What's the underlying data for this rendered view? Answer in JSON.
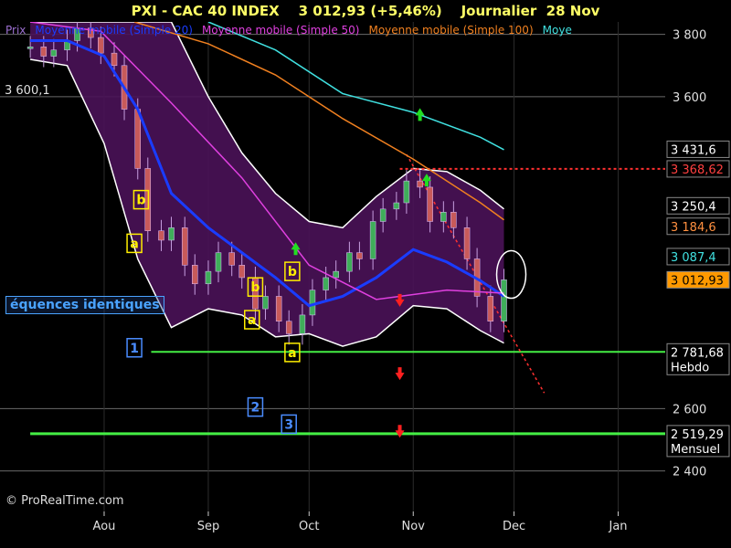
{
  "header": {
    "title": "PXI - CAC 40 INDEX    3 012,93 (+5,46%)    Journalier  28 Nov"
  },
  "legend": [
    {
      "label": "Prix",
      "color": "#9b6fd0"
    },
    {
      "label": "Moyenne mobile (Simple 20)",
      "color": "#1a3cff"
    },
    {
      "label": "Moyenne mobile (Simple 50)",
      "color": "#e040e0"
    },
    {
      "label": "Moyenne mobile (Simple 100)",
      "color": "#f08020"
    },
    {
      "label": "Moye",
      "color": "#40e0e0"
    }
  ],
  "copyright": "© ProRealTime.com",
  "annotation": "équences identiques",
  "chart_data": {
    "type": "candlestick",
    "y_scale": "linear",
    "ylim": [
      2270,
      3840
    ],
    "x_labels": [
      {
        "label": "Aou",
        "x": "2008-08-01"
      },
      {
        "label": "Sep",
        "x": "2008-09-01"
      },
      {
        "label": "Oct",
        "x": "2008-10-01"
      },
      {
        "label": "Nov",
        "x": "2008-11-01"
      },
      {
        "label": "Dec",
        "x": "2008-12-01"
      },
      {
        "label": "Jan",
        "x": "2009-01-01"
      }
    ],
    "y_ticks": [
      "3 800",
      "3 600",
      "2 600",
      "2 400"
    ],
    "left_label": {
      "text": "3 600,1",
      "value": 3600
    },
    "price_badges": [
      {
        "text": "3 431,6",
        "value": 3431.6,
        "bg": "#000000",
        "fg": "#ffffff"
      },
      {
        "text": "3 368,62",
        "value": 3368.62,
        "bg": "#000000",
        "fg": "#ff4040"
      },
      {
        "text": "3 250,4",
        "value": 3250.4,
        "bg": "#000000",
        "fg": "#ffffff"
      },
      {
        "text": "3 184,6",
        "value": 3184.6,
        "bg": "#000000",
        "fg": "#ff9040"
      },
      {
        "text": "3 087,4",
        "value": 3087.4,
        "bg": "#000000",
        "fg": "#40e0e0"
      },
      {
        "text": "3 012,93",
        "value": 3012.93,
        "bg": "#ff9900",
        "fg": "#000000"
      },
      {
        "text": "2 781,68",
        "value": 2781.68,
        "bg": "#000000",
        "fg": "#ffffff",
        "sub": "Hebdo"
      },
      {
        "text": "2 519,29",
        "value": 2519.29,
        "bg": "#000000",
        "fg": "#ffffff",
        "sub": "Mensuel"
      }
    ],
    "h_lines": [
      {
        "value": 2781.68,
        "color": "#44ee44",
        "width": 2,
        "from": "2008-08-15"
      },
      {
        "value": 2519.29,
        "color": "#44ee44",
        "width": 3,
        "from": "2008-07-10"
      },
      {
        "value": 3368.62,
        "color": "#ff3030",
        "width": 2,
        "dash": "3,3",
        "from": "2008-10-28"
      }
    ],
    "trendline": {
      "from": {
        "x": "2008-10-30",
        "y": 3415
      },
      "to": {
        "x": "2008-12-10",
        "y": 2650
      },
      "color": "#ff3030"
    },
    "series": [
      {
        "name": "Prix",
        "color": "#9b6fd0",
        "x": [
          "2008-07-10",
          "2008-07-14",
          "2008-07-17",
          "2008-07-21",
          "2008-07-24",
          "2008-07-28",
          "2008-07-31",
          "2008-08-04",
          "2008-08-07",
          "2008-08-11",
          "2008-08-14",
          "2008-08-18",
          "2008-08-21",
          "2008-08-25",
          "2008-08-28",
          "2008-09-01",
          "2008-09-04",
          "2008-09-08",
          "2008-09-11",
          "2008-09-15",
          "2008-09-18",
          "2008-09-22",
          "2008-09-25",
          "2008-09-29",
          "2008-10-02",
          "2008-10-06",
          "2008-10-09",
          "2008-10-13",
          "2008-10-16",
          "2008-10-20",
          "2008-10-23",
          "2008-10-27",
          "2008-10-30",
          "2008-11-03",
          "2008-11-06",
          "2008-11-10",
          "2008-11-13",
          "2008-11-17",
          "2008-11-20",
          "2008-11-24",
          "2008-11-28"
        ],
        "values": [
          3760,
          3730,
          3750,
          3780,
          3820,
          3790,
          3740,
          3700,
          3560,
          3370,
          3170,
          3140,
          3180,
          3060,
          3000,
          3040,
          3100,
          3060,
          3020,
          2920,
          2960,
          2880,
          2840,
          2900,
          2980,
          3020,
          3040,
          3100,
          3080,
          3200,
          3240,
          3260,
          3330,
          3310,
          3200,
          3230,
          3180,
          3080,
          2960,
          2880,
          3012.93
        ]
      },
      {
        "name": "Moyenne mobile (Simple 20)",
        "color": "#1a3cff",
        "x": [
          "2008-07-10",
          "2008-07-21",
          "2008-08-01",
          "2008-08-11",
          "2008-08-21",
          "2008-09-01",
          "2008-09-11",
          "2008-09-21",
          "2008-10-01",
          "2008-10-11",
          "2008-10-21",
          "2008-11-01",
          "2008-11-11",
          "2008-11-21",
          "2008-11-28"
        ],
        "values": [
          3780,
          3780,
          3730,
          3560,
          3290,
          3180,
          3100,
          3020,
          2930,
          2960,
          3020,
          3110,
          3070,
          3010,
          2960
        ]
      },
      {
        "name": "Moyenne mobile (Simple 50)",
        "color": "#e040e0",
        "x": [
          "2008-07-10",
          "2008-07-31",
          "2008-08-21",
          "2008-09-11",
          "2008-10-01",
          "2008-10-21",
          "2008-11-11",
          "2008-11-28"
        ],
        "values": [
          3840,
          3810,
          3580,
          3340,
          3060,
          2950,
          2980,
          2970
        ]
      },
      {
        "name": "Moyenne mobile (Simple 100)",
        "color": "#f08020",
        "x": [
          "2008-08-10",
          "2008-09-01",
          "2008-09-21",
          "2008-10-11",
          "2008-11-01",
          "2008-11-21",
          "2008-11-28"
        ],
        "values": [
          3840,
          3770,
          3670,
          3530,
          3400,
          3260,
          3205
        ]
      },
      {
        "name": "Moye",
        "color": "#40e0e0",
        "x": [
          "2008-09-01",
          "2008-09-21",
          "2008-10-11",
          "2008-11-01",
          "2008-11-21",
          "2008-11-28"
        ],
        "values": [
          3840,
          3750,
          3610,
          3550,
          3470,
          3430
        ]
      }
    ],
    "bands": {
      "x": [
        "2008-07-10",
        "2008-07-21",
        "2008-08-01",
        "2008-08-11",
        "2008-08-21",
        "2008-09-01",
        "2008-09-11",
        "2008-09-21",
        "2008-10-01",
        "2008-10-11",
        "2008-10-21",
        "2008-11-01",
        "2008-11-11",
        "2008-11-21",
        "2008-11-28"
      ],
      "upper": [
        3840,
        3840,
        3840,
        3840,
        3840,
        3600,
        3420,
        3290,
        3200,
        3180,
        3280,
        3370,
        3360,
        3300,
        3240
      ],
      "lower": [
        3720,
        3700,
        3450,
        3080,
        2860,
        2920,
        2900,
        2830,
        2840,
        2800,
        2830,
        2930,
        2920,
        2850,
        2810
      ]
    },
    "labels_boxed": [
      {
        "text": "1",
        "x": "2008-08-10",
        "y": 2795,
        "color": "#4a8cff"
      },
      {
        "text": "2",
        "x": "2008-09-15",
        "y": 2605,
        "color": "#4a8cff"
      },
      {
        "text": "3",
        "x": "2008-09-25",
        "y": 2550,
        "color": "#4a8cff"
      },
      {
        "text": "b",
        "x": "2008-08-12",
        "y": 3270,
        "color": "#ffee00"
      },
      {
        "text": "a",
        "x": "2008-08-10",
        "y": 3130,
        "color": "#ffee00"
      },
      {
        "text": "b",
        "x": "2008-09-15",
        "y": 2990,
        "color": "#ffee00"
      },
      {
        "text": "a",
        "x": "2008-09-14",
        "y": 2885,
        "color": "#ffee00"
      },
      {
        "text": "b",
        "x": "2008-09-26",
        "y": 3040,
        "color": "#ffee00"
      },
      {
        "text": "a",
        "x": "2008-09-26",
        "y": 2780,
        "color": "#ffee00"
      }
    ],
    "arrows": [
      {
        "x": "2008-09-27",
        "y": 3110,
        "dir": "up",
        "color": "#22dd22"
      },
      {
        "x": "2008-11-03",
        "y": 3540,
        "dir": "up",
        "color": "#22dd22"
      },
      {
        "x": "2008-11-05",
        "y": 3330,
        "dir": "up",
        "color": "#22dd22"
      },
      {
        "x": "2008-10-28",
        "y": 2950,
        "dir": "down",
        "color": "#ff2020"
      },
      {
        "x": "2008-10-28",
        "y": 2715,
        "dir": "down",
        "color": "#ff2020"
      },
      {
        "x": "2008-10-28",
        "y": 2530,
        "dir": "down",
        "color": "#ff2020"
      }
    ]
  }
}
